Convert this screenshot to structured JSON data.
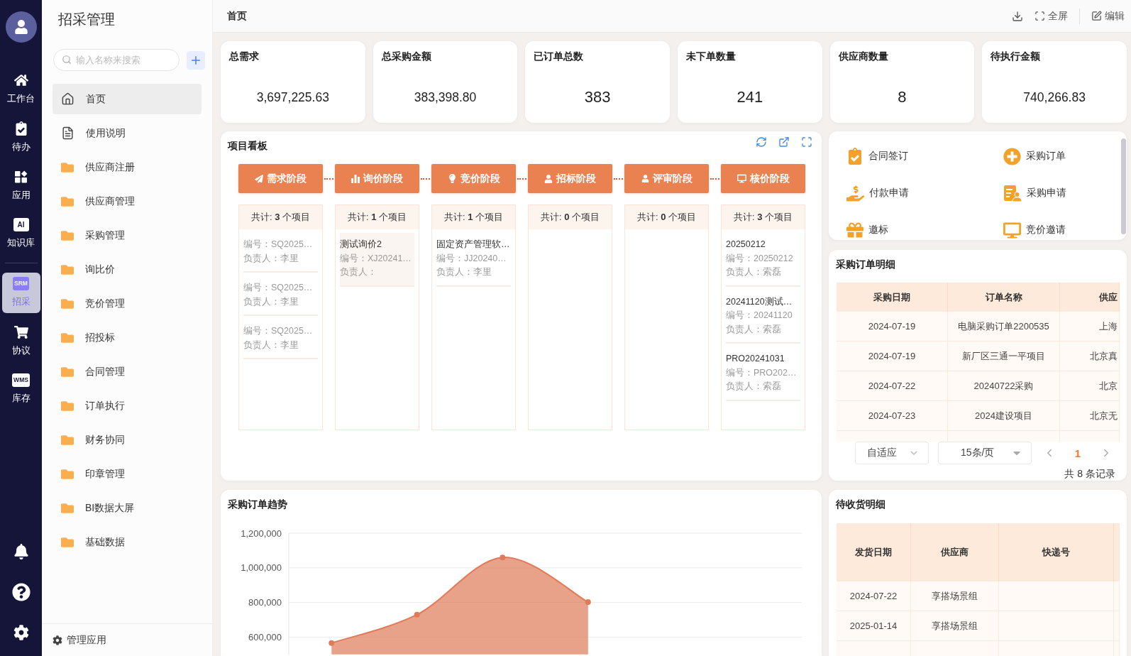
{
  "rail": {
    "top_items": [
      {
        "label": "工作台",
        "selected": false
      },
      {
        "label": "待办",
        "selected": false
      },
      {
        "label": "应用",
        "selected": false
      },
      {
        "label": "知识库",
        "icon_text": "AI",
        "selected": false
      }
    ],
    "app_items": [
      {
        "label": "招采",
        "icon_text": "SRM",
        "selected": true
      },
      {
        "label": "协议",
        "selected": false
      },
      {
        "label": "库存",
        "icon_text": "WMS",
        "selected": false
      }
    ]
  },
  "sidebar": {
    "title": "招采管理",
    "search": {
      "placeholder": "输入名称来搜索"
    },
    "items": [
      {
        "label": "首页",
        "kind": "home",
        "selected": true
      },
      {
        "label": "使用说明",
        "kind": "document",
        "selected": false
      },
      {
        "label": "供应商注册",
        "kind": "folder",
        "selected": false
      },
      {
        "label": "供应商管理",
        "kind": "folder",
        "selected": false
      },
      {
        "label": "采购管理",
        "kind": "folder",
        "selected": false
      },
      {
        "label": "询比价",
        "kind": "folder",
        "selected": false
      },
      {
        "label": "竞价管理",
        "kind": "folder",
        "selected": false
      },
      {
        "label": "招投标",
        "kind": "folder",
        "selected": false
      },
      {
        "label": "合同管理",
        "kind": "folder",
        "selected": false
      },
      {
        "label": "订单执行",
        "kind": "folder",
        "selected": false
      },
      {
        "label": "财务协同",
        "kind": "folder",
        "selected": false
      },
      {
        "label": "印章管理",
        "kind": "folder",
        "selected": false
      },
      {
        "label": "BI数据大屏",
        "kind": "folder",
        "selected": false
      },
      {
        "label": "基础数据",
        "kind": "folder",
        "selected": false
      }
    ],
    "footer": "管理应用"
  },
  "topbar": {
    "title": "首页",
    "actions": [
      {
        "kind": "download"
      },
      {
        "kind": "fullscreen",
        "label": "全屏"
      },
      {
        "kind": "edit",
        "label": "编辑"
      }
    ]
  },
  "stats": [
    {
      "label": "总需求",
      "value": "3,697,225.63"
    },
    {
      "label": "总采购金额",
      "value": "383,398.80"
    },
    {
      "label": "已订单总数",
      "value": "383"
    },
    {
      "label": "未下单数量",
      "value": "241"
    },
    {
      "label": "供应商数量",
      "value": "8"
    },
    {
      "label": "待执行金额",
      "value": "740,266.83"
    }
  ],
  "kanban": {
    "title": "项目看板",
    "stages": [
      {
        "label": "需求阶段",
        "summary": "共计: **3** 个项目",
        "cards": [
          {
            "code": "编号：SQ2025…",
            "owner": "负责人：李里",
            "highlighted": false
          },
          {
            "code": "编号：SQ2025…",
            "owner": "负责人：李里",
            "highlighted": false
          },
          {
            "code": "编号：SQ2025…",
            "owner": "负责人：李里",
            "highlighted": false
          }
        ]
      },
      {
        "label": "询价阶段",
        "summary": "共计: **1** 个项目",
        "cards": [
          {
            "title": "测试询价2",
            "code": "编号：XJ20241…",
            "owner": "负责人：",
            "highlighted": true
          }
        ]
      },
      {
        "label": "竞价阶段",
        "summary": "共计: **1** 个项目",
        "cards": [
          {
            "title": "固定资产管理软…",
            "code": "编号：JJ20240…",
            "owner": "负责人：李里",
            "highlighted": false
          }
        ]
      },
      {
        "label": "招标阶段",
        "summary": "共计: **0** 个项目"
      },
      {
        "label": "评审阶段",
        "summary": "共计: **0** 个项目"
      },
      {
        "label": "核价阶段",
        "summary": "共计: **3** 个项目",
        "cards": [
          {
            "title": "20250212",
            "code": "编号：20250212",
            "owner": "负责人：索磊",
            "highlighted": false
          },
          {
            "title": "20241120测试…",
            "code": "编号：20241120",
            "owner": "负责人：索磊",
            "highlighted": false
          },
          {
            "title": "PRO20241031",
            "code": "编号：PRO202…",
            "owner": "负责人：索磊",
            "highlighted": false
          }
        ]
      }
    ]
  },
  "quick_actions": [
    {
      "label": "合同签订"
    },
    {
      "label": "采购订单"
    },
    {
      "label": "付款申请"
    },
    {
      "label": "采购申请"
    },
    {
      "label": "邀标"
    },
    {
      "label": "竞价邀请"
    }
  ],
  "orders": {
    "title": "采购订单明细",
    "columns": [
      "采购日期",
      "订单名称",
      "供应"
    ],
    "rows": [
      [
        "2024-07-19",
        "电脑采购订单2200535",
        "上海"
      ],
      [
        "2024-07-19",
        "新厂区三通一平项目",
        "北京真"
      ],
      [
        "2024-07-22",
        "20240722采购",
        "北京"
      ],
      [
        "2024-07-23",
        "2024建设项目",
        "北京无"
      ]
    ],
    "pagination": {
      "fit": "自适应",
      "page_size": "15条/页",
      "pages": [
        {
          "label": "1",
          "selected": true
        }
      ],
      "total": "共 8 条记录"
    }
  },
  "trend": {
    "title": "采购订单趋势",
    "chart_data": {
      "type": "area",
      "grid": true,
      "categories": [
        null,
        null,
        null,
        null,
        null,
        null
      ],
      "ylim": [
        500000,
        1200000
      ],
      "yticks": [
        {
          "value": 600000,
          "label": "600,000"
        },
        {
          "value": 800000,
          "label": "800,000"
        },
        {
          "value": 1000000,
          "label": "1,000,000"
        },
        {
          "value": 1200000,
          "label": "1,200,000"
        }
      ],
      "series": [
        {
          "color": "#e07a58",
          "values": [
            566000,
            730000,
            1060000,
            802000,
            null,
            null
          ]
        }
      ]
    }
  },
  "receipts": {
    "title": "待收货明细",
    "columns": [
      "发货日期",
      "供应商",
      "快递号"
    ],
    "rows": [
      [
        "2024-07-22",
        "享搭场景组"
      ],
      [
        "2025-01-14",
        "享搭场景组"
      ]
    ]
  }
}
